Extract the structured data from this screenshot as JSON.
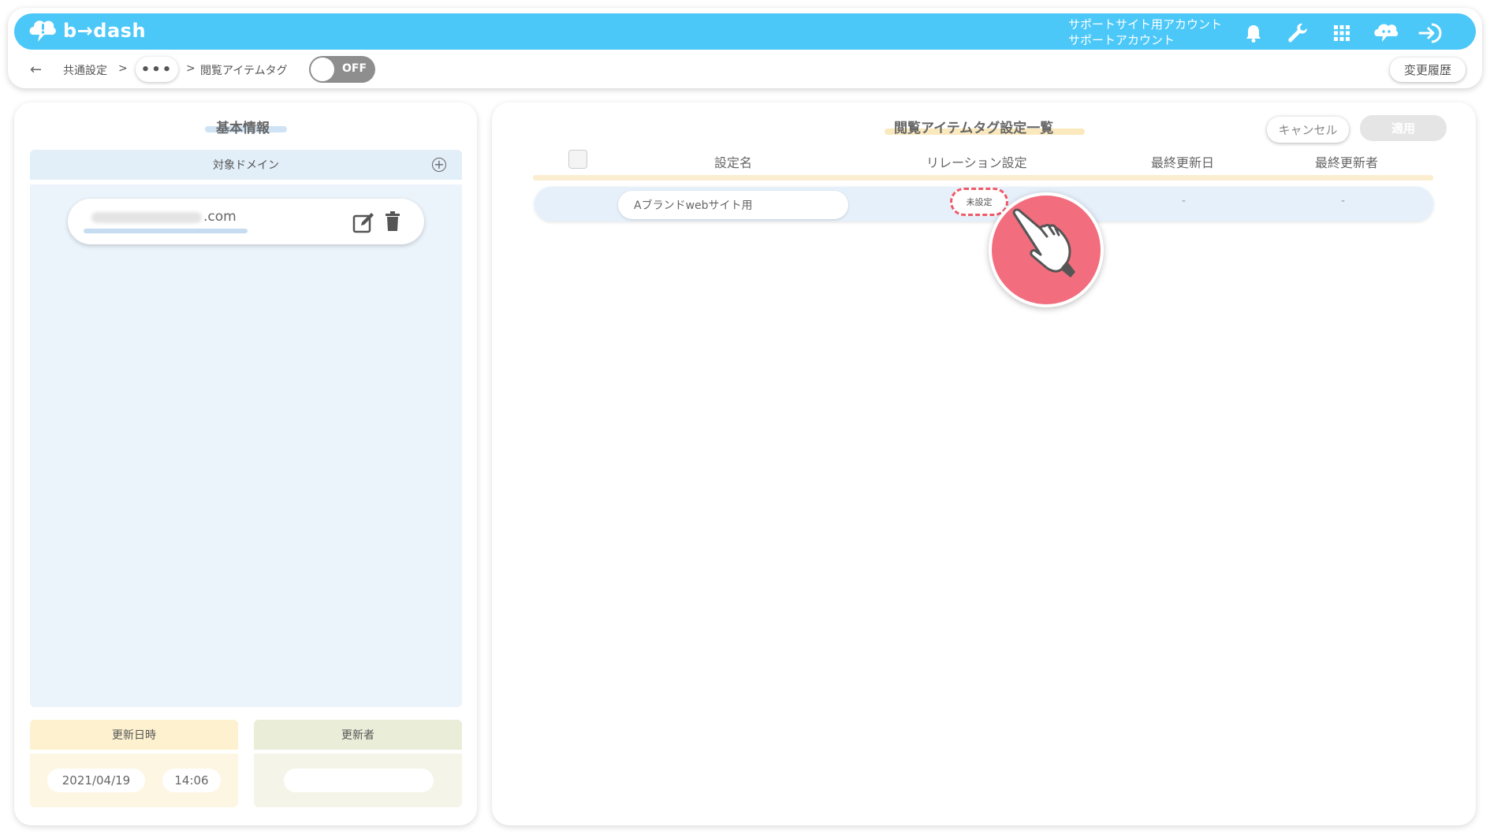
{
  "app": {
    "logo_text": "b→dash"
  },
  "header": {
    "account_line1": "サポートサイト用アカウント",
    "account_line2": "サポートアカウント",
    "icons": [
      "bell-icon",
      "wrench-icon",
      "apps-grid-icon",
      "chat-robot-icon",
      "logout-icon"
    ]
  },
  "breadcrumb": {
    "back_glyph": "←",
    "item1": "共通設定",
    "sep1": ">",
    "more": "•••",
    "sep2": ">",
    "current": "閲覧アイテムタグ"
  },
  "toggle": {
    "label": "OFF",
    "state": "off"
  },
  "history_button": "変更履歴",
  "left_panel": {
    "title": "基本情報",
    "domain_header": "対象ドメイン",
    "add_glyph": "+",
    "domain_suffix": ".com",
    "updated_at_header": "更新日時",
    "updater_header": "更新者",
    "updated_date": "2021/04/19",
    "updated_time": "14:06"
  },
  "right_panel": {
    "title": "閲覧アイテムタグ設定一覧",
    "cancel_label": "キャンセル",
    "apply_label": "適用",
    "columns": [
      "設定名",
      "リレーション設定",
      "最終更新日",
      "最終更新者"
    ],
    "rows": [
      {
        "name": "Aブランドwebサイト用",
        "relation": "未設定",
        "last_updated": "-",
        "last_updater": "-"
      }
    ]
  },
  "colors": {
    "topbar": "#4cc8f8",
    "accent_red": "#f26d7d",
    "dash_outline": "#f0596a",
    "panel_blue": "#ebf3fb",
    "panel_yellow": "#fdf6e3",
    "panel_green": "#f4f5e8"
  }
}
